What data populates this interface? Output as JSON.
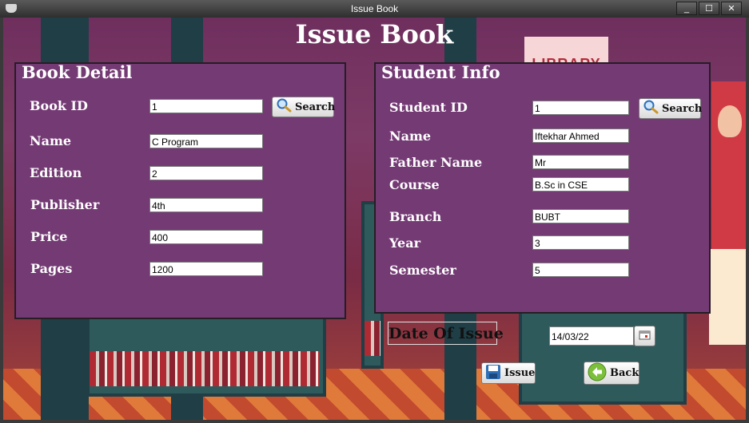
{
  "window": {
    "title": "Issue Book",
    "minimize": "_",
    "maximize": "☐",
    "close": "✕"
  },
  "page_title": "Issue Book",
  "background": {
    "sign_text": "LIBRARY"
  },
  "book_detail": {
    "legend": "Book Detail",
    "book_id_label": "Book ID",
    "book_id_value": "1",
    "search_label": "Search",
    "name_label": "Name",
    "name_value": "C Program",
    "edition_label": "Edition",
    "edition_value": "2",
    "publisher_label": "Publisher",
    "publisher_value": "4th",
    "price_label": "Price",
    "price_value": "400",
    "pages_label": "Pages",
    "pages_value": "1200"
  },
  "student_info": {
    "legend": "Student Info",
    "student_id_label": "Student ID",
    "student_id_value": "1",
    "search_label": "Search",
    "name_label": "Name",
    "name_value": "Iftekhar Ahmed",
    "father_label": "Father Name",
    "father_value": "Mr",
    "course_label": "Course",
    "course_value": "B.Sc in CSE",
    "branch_label": "Branch",
    "branch_value": "BUBT",
    "year_label": "Year",
    "year_value": "3",
    "semester_label": "Semester",
    "semester_value": "5"
  },
  "issue": {
    "date_label": "Date Of Issue",
    "date_value": "14/03/22",
    "issue_button": "Issue",
    "back_button": "Back"
  },
  "colors": {
    "panel": "#743a74",
    "accent_green": "#7bbf3a",
    "search_blue": "#2f6fb6"
  }
}
